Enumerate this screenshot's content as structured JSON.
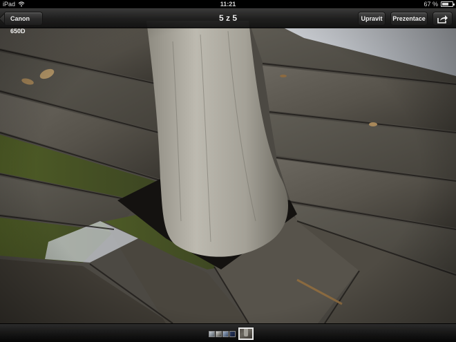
{
  "status_bar": {
    "device": "iPad",
    "time": "11:21",
    "battery_text": "67 %",
    "battery_level": 0.67
  },
  "nav_bar": {
    "back_label": "Canon 650D",
    "title": "5 z 5",
    "edit_label": "Upravit",
    "slideshow_label": "Prezentace",
    "share_icon": "share-icon"
  },
  "photo": {
    "subject": "tree-trunk-through-wooden-boardwalk"
  },
  "filmstrip": {
    "total": 5,
    "current": 5
  },
  "colors": {
    "bar_dark": "#1c1c1c",
    "button_text": "#ffffff",
    "wood": "#5e5a52",
    "trunk": "#a9a69c",
    "moss": "#5c6a2e"
  }
}
